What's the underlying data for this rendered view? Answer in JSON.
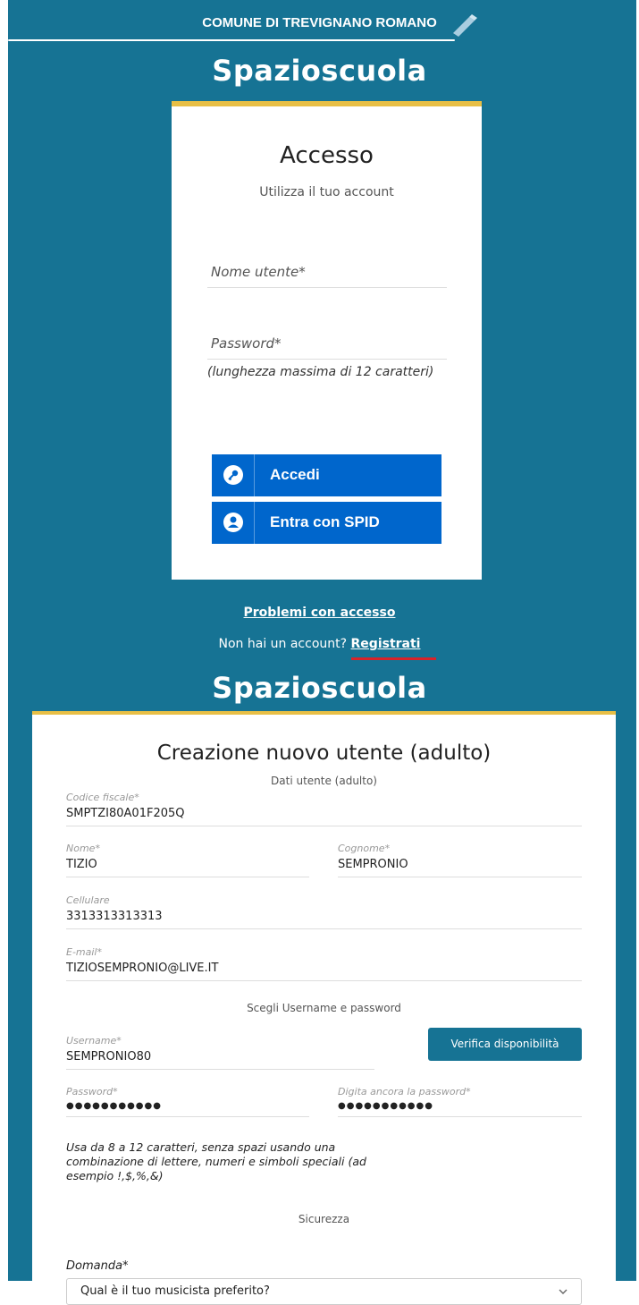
{
  "header": {
    "comune": "COMUNE DI TREVIGNANO ROMANO",
    "brand": "Spazioscuola"
  },
  "login": {
    "title": "Accesso",
    "subtitle": "Utilizza il tuo account",
    "username_placeholder": "Nome utente*",
    "password_placeholder": "Password*",
    "password_hint": "(lunghezza massima di 12 caratteri)",
    "login_button": "Accedi",
    "spid_button": "Entra con SPID",
    "problems_link": "Problemi con accesso",
    "no_account_text": "Non hai un account?",
    "register_link": "Registrati"
  },
  "register": {
    "brand": "Spazioscuola",
    "title": "Creazione nuovo utente (adulto)",
    "section_user": "Dati utente (adulto)",
    "codice_fiscale": {
      "label": "Codice fiscale*",
      "value": "SMPTZI80A01F205Q"
    },
    "nome": {
      "label": "Nome*",
      "value": "TIZIO"
    },
    "cognome": {
      "label": "Cognome*",
      "value": "SEMPRONIO"
    },
    "cellulare": {
      "label": "Cellulare",
      "value": "3313313313313"
    },
    "email": {
      "label": "E-mail*",
      "value": "TIZIOSEMPRONIO@LIVE.IT"
    },
    "section_credentials": "Scegli Username e password",
    "username": {
      "label": "Username*",
      "value": "SEMPRONIO80"
    },
    "verify_button": "Verifica disponibilità",
    "password": {
      "label": "Password*",
      "value": "●●●●●●●●●●●"
    },
    "password_confirm": {
      "label": "Digita ancora la password*",
      "value": "●●●●●●●●●●●"
    },
    "password_hint": "Usa da 8 a 12 caratteri, senza spazi usando una combinazione di lettere, numeri e simboli speciali (ad esempio !,$,%,&)",
    "section_security": "Sicurezza",
    "domanda_label": "Domanda*",
    "domanda_value": "Qual è il tuo musicista preferito?"
  },
  "colors": {
    "background": "#167394",
    "accent": "#e8bf45",
    "button_blue": "#0066cc",
    "underline_red": "#d8232a"
  },
  "icons": {
    "header": "pencil-icon",
    "login": "key-icon",
    "spid": "user-icon",
    "select": "chevron-down-icon"
  }
}
